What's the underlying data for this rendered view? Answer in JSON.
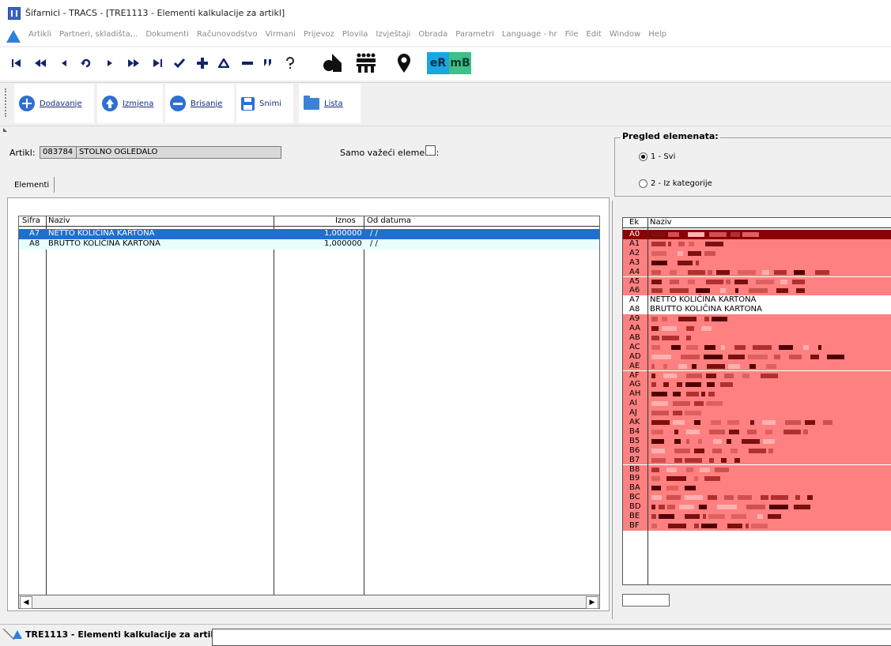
{
  "window": {
    "title": "Šifarnici - TRACS - [TRE1113 - Elementi kalkulacije za artikl]"
  },
  "menu": {
    "items": [
      "Artikli",
      "Partneri, skladišta,..",
      "Dokumenti",
      "Računovodstvo",
      "Virmani",
      "Prijevoz",
      "Plovila",
      "Izvještaji",
      "Obrada",
      "Parametri",
      "Language - hr",
      "File",
      "Edit",
      "Window",
      "Help"
    ]
  },
  "navbar": {
    "er_label": "eR",
    "mb_label": "mB"
  },
  "actions": {
    "add": "Dodavanje",
    "edit": "Izmjena",
    "delete": "Brisanje",
    "save": "Snimi",
    "list": "Lista"
  },
  "form": {
    "artikl_label": "Artikl:",
    "artikl_code": "083784",
    "artikl_name": "STOLNO OGLEDALO",
    "samo_label": "Samo važeći elementi:",
    "tab_label": "Elementi"
  },
  "grid_left": {
    "columns": [
      "Šifra",
      "Naziv",
      "Iznos",
      "Od datuma"
    ],
    "rows": [
      {
        "code": "A7",
        "name": "NETTO KOLIČINA KARTONA",
        "amount": "1,000000",
        "date": " / /"
      },
      {
        "code": "A8",
        "name": "BRUTTO KOLIČINA KARTONA",
        "amount": "1,000000",
        "date": " / /"
      }
    ]
  },
  "pregled": {
    "title": "Pregled elemenata:",
    "option1": "1 - Svi",
    "option2": "2 - Iz kategorije",
    "selected": "1 - Svi"
  },
  "grid_right": {
    "columns": [
      "Ek",
      "Naziv"
    ],
    "codes": [
      "A0",
      "A1",
      "A2",
      "A3",
      "A4",
      "A5",
      "A6",
      "A7",
      "A8",
      "A9",
      "AA",
      "AB",
      "AC",
      "AD",
      "AE",
      "AF",
      "AG",
      "AH",
      "AI",
      "AJ",
      "AK",
      "B4",
      "B5",
      "B6",
      "B7",
      "B8",
      "B9",
      "BA",
      "BC",
      "BD",
      "BE",
      "BF"
    ],
    "visible_names": {
      "A7": "NETTO KOLIČINA KARTONA",
      "A8": "BRUTTO KOLIČINA KARTONA"
    },
    "colors": {
      "header_row": "#8b0000",
      "row_bg": "#ff8080",
      "plain_row": "#ffffff"
    }
  },
  "statusbar": {
    "tab_label": "TRE1113 - Elementi kalkulacije za artikl"
  },
  "colors": {
    "selection": "#1e6fd0",
    "alt_row": "#e8ffff"
  }
}
